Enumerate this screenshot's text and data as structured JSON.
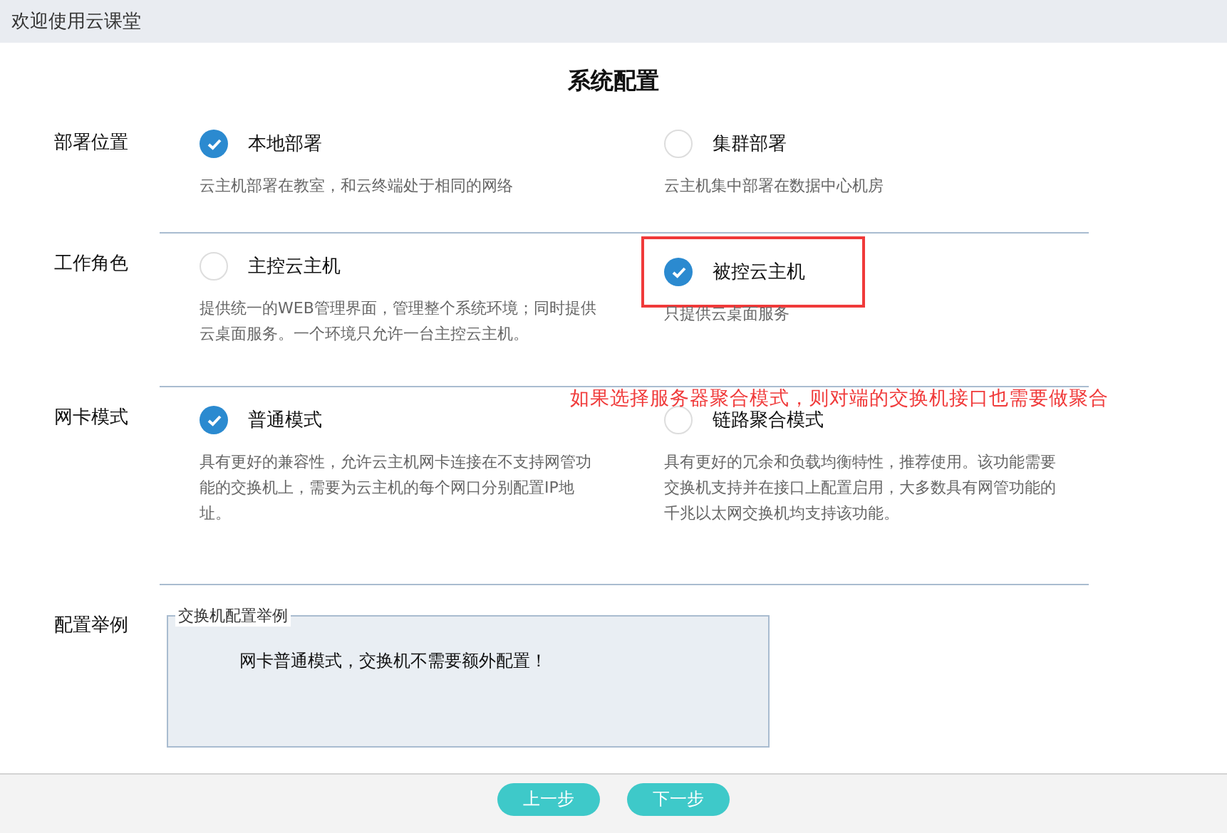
{
  "window": {
    "title": "欢迎使用云课堂"
  },
  "heading": "系统配置",
  "sections": [
    {
      "label": "部署位置",
      "options": [
        {
          "label": "本地部署",
          "selected": true,
          "highlighted": false,
          "description": "云主机部署在教室，和云终端处于相同的网络"
        },
        {
          "label": "集群部署",
          "selected": false,
          "highlighted": false,
          "description": "云主机集中部署在数据中心机房"
        }
      ]
    },
    {
      "label": "工作角色",
      "options": [
        {
          "label": "主控云主机",
          "selected": false,
          "highlighted": false,
          "description": "提供统一的WEB管理界面，管理整个系统环境；同时提供云桌面服务。一个环境只允许一台主控云主机。"
        },
        {
          "label": "被控云主机",
          "selected": true,
          "highlighted": true,
          "description": "只提供云桌面服务"
        }
      ]
    },
    {
      "label": "网卡模式",
      "annotation": "如果选择服务器聚合模式，则对端的交换机接口也需要做聚合",
      "options": [
        {
          "label": "普通模式",
          "selected": true,
          "highlighted": false,
          "description": "具有更好的兼容性，允许云主机网卡连接在不支持网管功能的交换机上，需要为云主机的每个网口分别配置IP地址。"
        },
        {
          "label": "链路聚合模式",
          "selected": false,
          "highlighted": false,
          "description": "具有更好的冗余和负载均衡特性，推荐使用。该功能需要交换机支持并在接口上配置启用，大多数具有网管功能的千兆以太网交换机均支持该功能。"
        }
      ]
    }
  ],
  "example": {
    "label": "配置举例",
    "legend": "交换机配置举例",
    "text": "网卡普通模式，交换机不需要额外配置！"
  },
  "buttons": [
    "上一步",
    "下一步"
  ]
}
